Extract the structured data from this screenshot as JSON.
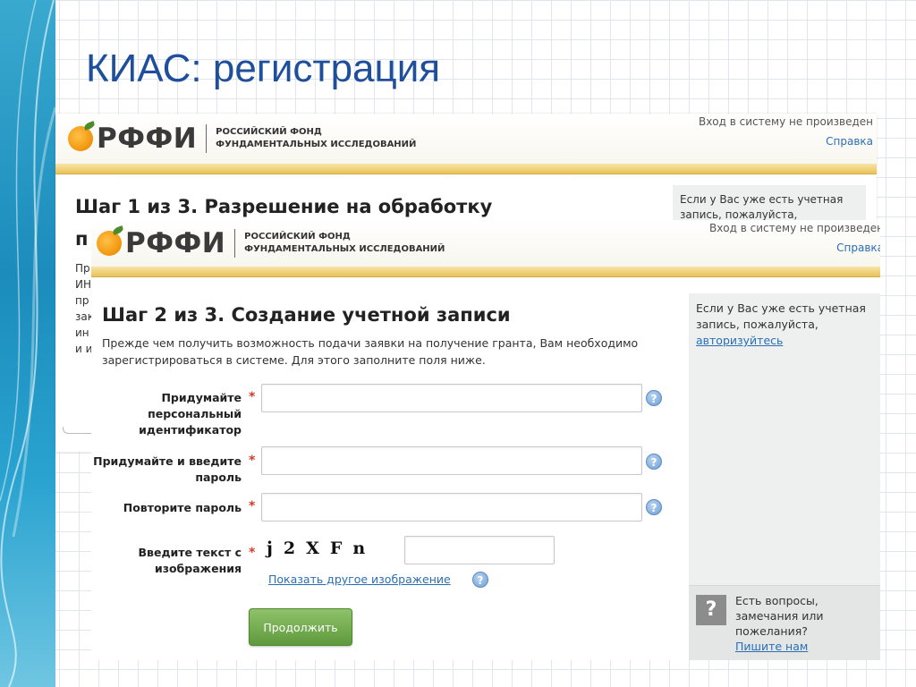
{
  "slide": {
    "title": "КИАС: регистрация"
  },
  "brand": {
    "name": "РФФИ",
    "subtitle_line1": "РОССИЙСКИЙ ФОНД",
    "subtitle_line2": "ФУНДАМЕНТАЛЬНЫХ ИССЛЕДОВАНИЙ",
    "login_status": "Вход в систему не произведен",
    "help_link": "Справка"
  },
  "step1": {
    "title": "Шаг 1 из 3. Разрешение на обработку",
    "title_cont": "п",
    "sidebar_text": "Если у Вас уже есть учетная запись, пожалуйста,",
    "paragraph_fragments": [
      "Пр",
      "ИН",
      "пр",
      "зак",
      "ин",
      "и и"
    ]
  },
  "step2": {
    "title": "Шаг 2 из 3. Создание учетной записи",
    "intro": "Прежде чем получить возможность подачи заявки на получение гранта, Вам необходимо зарегистрироваться в системе. Для этого заполните поля ниже.",
    "sidebar_text": "Если у Вас уже есть учетная запись, пожалуйста,",
    "sidebar_link": "авторизуйтесь",
    "fields": {
      "identifier_label": "Придумайте персональный идентификатор",
      "identifier_value": "",
      "password_label": "Придумайте и введите пароль",
      "password_value": "",
      "repeat_label": "Повторите пароль",
      "repeat_value": "",
      "captcha_label": "Введите текст с изображения",
      "captcha_value": ""
    },
    "required_mark": "*",
    "help_glyph": "?",
    "captcha_text": "j2XFn",
    "other_image_link": "Показать другое изображение",
    "continue_button": "Продолжить",
    "questions": {
      "icon_glyph": "?",
      "text": "Есть вопросы, замечания или пожелания?",
      "link": "Пишите нам"
    }
  },
  "colors": {
    "title_blue": "#1f4f9c",
    "gold_bar": "#e8c25a",
    "link_blue": "#2a6fb5",
    "required_red": "#d43a2a",
    "button_green": "#6fa94a"
  }
}
